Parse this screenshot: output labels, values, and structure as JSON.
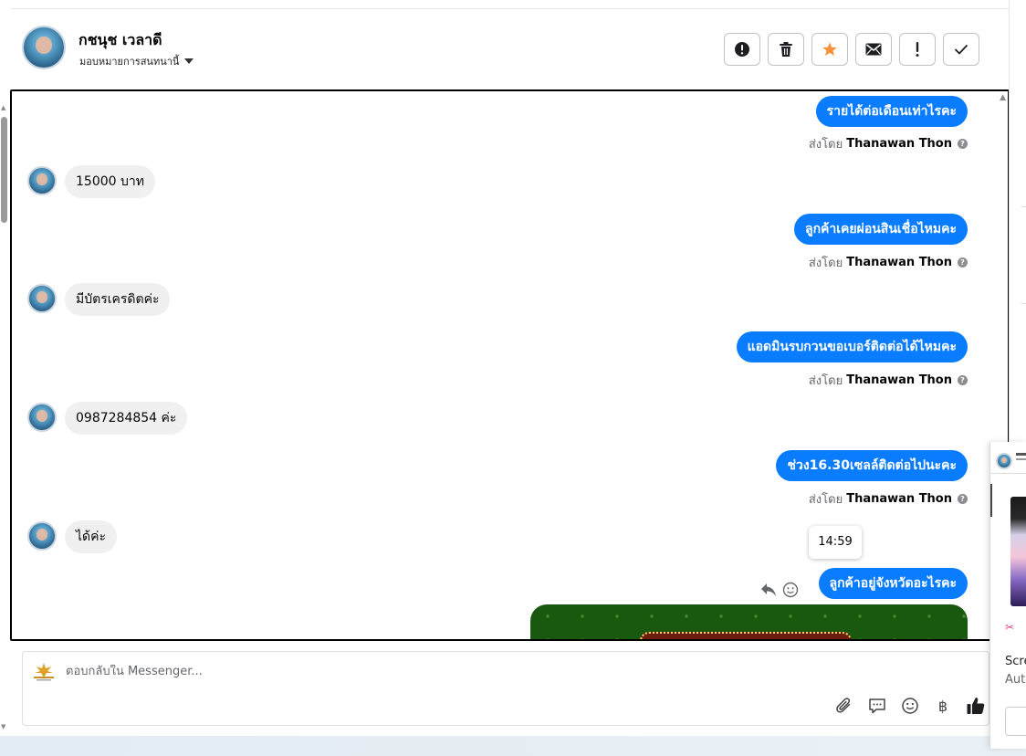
{
  "contact": {
    "name": "กชนุช เวลาดี",
    "assign_label": "มอบหมายการสนทนานี้"
  },
  "toolbar": {
    "buttons": [
      {
        "name": "spam",
        "icon": "exclamation-circle-icon"
      },
      {
        "name": "delete",
        "icon": "trash-icon"
      },
      {
        "name": "star",
        "icon": "star-icon",
        "color": "#f7923a"
      },
      {
        "name": "mark-unread",
        "icon": "envelope-icon"
      },
      {
        "name": "follow-up",
        "icon": "exclamation-icon"
      },
      {
        "name": "done",
        "icon": "checkmark-icon"
      }
    ]
  },
  "messages": [
    {
      "direction": "out",
      "text": "รายได้ต่อเดือนเท่าไรคะ",
      "sent_prefix": "ส่งโดย",
      "sender": "Thanawan Thon"
    },
    {
      "direction": "in",
      "text": "15000 บาท"
    },
    {
      "direction": "out",
      "text": "ลูกค้าเคยผ่อนสินเชื่อไหมคะ",
      "sent_prefix": "ส่งโดย",
      "sender": "Thanawan Thon"
    },
    {
      "direction": "in",
      "text": "มีบัตรเครดิตค่ะ"
    },
    {
      "direction": "out",
      "text": "แอดมินรบกวนขอเบอร์ติดต่อได้ไหมคะ",
      "sent_prefix": "ส่งโดย",
      "sender": "Thanawan Thon"
    },
    {
      "direction": "in",
      "text": "0987284854 ค่ะ"
    },
    {
      "direction": "out",
      "text": "ช่วง16.30เซลล์ติดต่อไปนะคะ",
      "sent_prefix": "ส่งโดย",
      "sender": "Thanawan Thon"
    },
    {
      "direction": "in",
      "text": "ได้ค่ะ"
    },
    {
      "direction": "out",
      "text": "ลูกค้าอยู่จังหวัดอะไรคะ"
    }
  ],
  "hover_timestamp": "14:59",
  "composer": {
    "placeholder": "ตอบกลับใน Messenger...",
    "tools": [
      "paperclip-icon",
      "chat-bubble-icon",
      "smiley-icon",
      "baht-icon",
      "thumbs-up-icon"
    ],
    "baht_glyph": "฿"
  },
  "side_notification": {
    "line1": "Scre",
    "line2": "Auto"
  },
  "colors": {
    "outgoing_bubble": "#0a7cff",
    "incoming_bubble": "#f0f0f0",
    "star": "#f7923a"
  }
}
